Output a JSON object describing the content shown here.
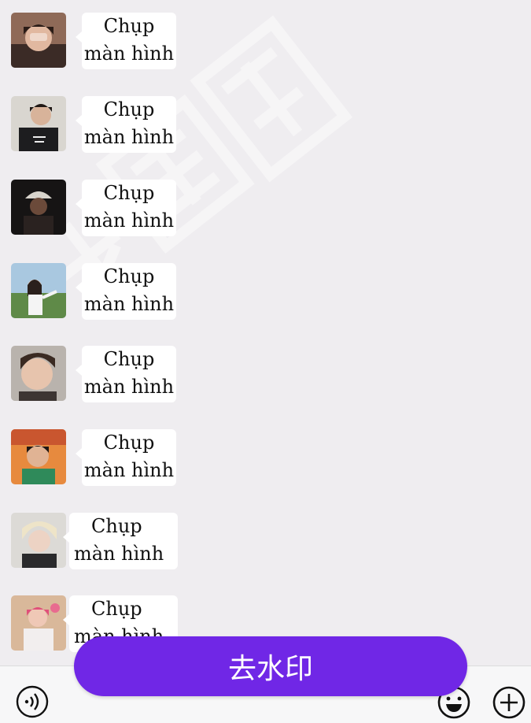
{
  "messages": [
    {
      "line1": "Chụp",
      "line2": "màn hình",
      "avatar": "avatar-person-hand-over-face"
    },
    {
      "line1": "Chụp",
      "line2": "màn hình",
      "avatar": "avatar-person-black-tshirt"
    },
    {
      "line1": "Chụp",
      "line2": "màn hình",
      "avatar": "avatar-person-bucket-hat-dark"
    },
    {
      "line1": "Chụp",
      "line2": "màn hình",
      "avatar": "avatar-person-outdoor-green"
    },
    {
      "line1": "Chụp",
      "line2": "màn hình",
      "avatar": "avatar-person-closeup"
    },
    {
      "line1": "Chụp",
      "line2": "màn hình",
      "avatar": "avatar-person-sunset"
    },
    {
      "line1": "Chụp",
      "line2": "màn hình",
      "avatar": "avatar-person-blonde"
    },
    {
      "line1": "Chụp",
      "line2": "màn hình",
      "avatar": "avatar-person-pink-hair"
    }
  ],
  "overlay_button": {
    "label": "去水印"
  },
  "bottom_bar": {
    "voice_icon": "voice-icon",
    "emoji_icon": "emoji-icon",
    "plus_icon": "plus-icon"
  },
  "colors": {
    "accent": "#7027e6",
    "background": "#efedf0",
    "bubble": "#ffffff"
  }
}
